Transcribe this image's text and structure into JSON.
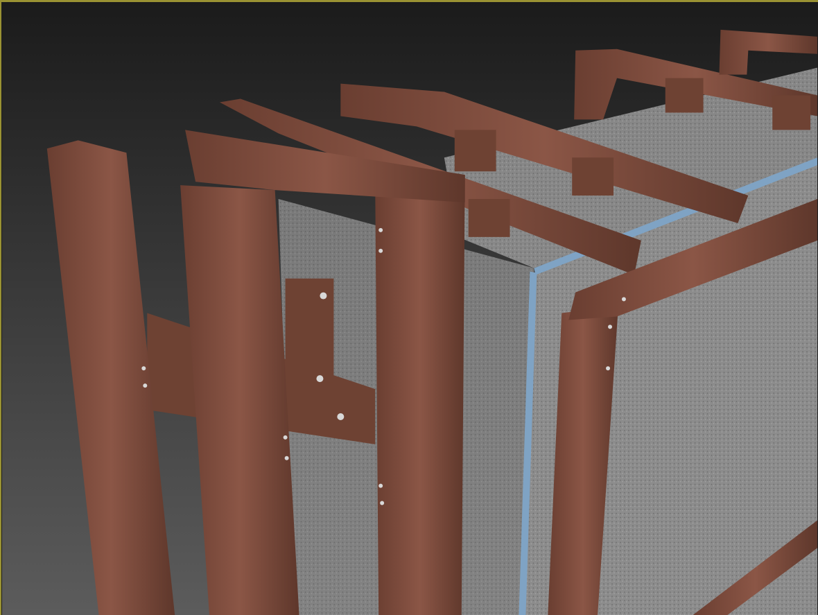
{
  "viewport": {
    "active_border_color": "#9a9233",
    "background_top": "#1b1b1b",
    "background_bottom": "#5c5c5c"
  },
  "scene": {
    "profile_color": "#7a4a3a",
    "concrete_color": "#8f8f8f",
    "membrane_color": "#7fa3c4"
  }
}
